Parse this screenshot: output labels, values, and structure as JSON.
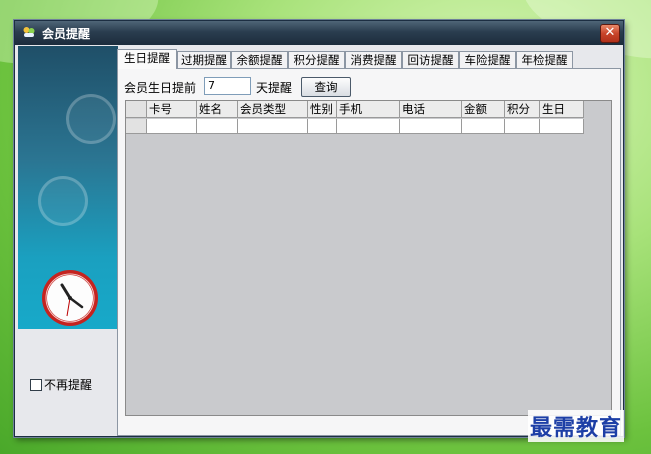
{
  "window": {
    "title": "会员提醒",
    "close_glyph": "✕"
  },
  "tabs": [
    {
      "label": "生日提醒",
      "active": true
    },
    {
      "label": "过期提醒",
      "active": false
    },
    {
      "label": "余额提醒",
      "active": false
    },
    {
      "label": "积分提醒",
      "active": false
    },
    {
      "label": "消费提醒",
      "active": false
    },
    {
      "label": "回访提醒",
      "active": false
    },
    {
      "label": "车险提醒",
      "active": false
    },
    {
      "label": "年检提醒",
      "active": false
    }
  ],
  "query": {
    "prefix_label": "会员生日提前",
    "days_value": "7",
    "suffix_label": "天提醒",
    "button_label": "查询"
  },
  "grid": {
    "columns": [
      "卡号",
      "姓名",
      "会员类型",
      "性别",
      "手机",
      "电话",
      "金额",
      "积分",
      "生日"
    ]
  },
  "sidebar": {
    "dont_remind_label": "不再提醒",
    "dont_remind_checked": false
  },
  "watermark": "最需教育",
  "icons": {
    "title_icon": "member-icon",
    "clock": "clock-icon",
    "close": "close-icon"
  }
}
